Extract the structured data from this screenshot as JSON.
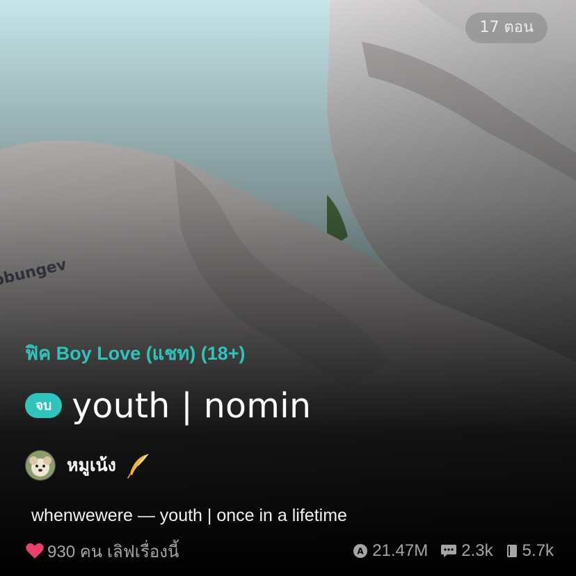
{
  "cover": {
    "episode_count": "17 ตอน",
    "category": "ฟิค Boy Love (แชท) (18+)",
    "status_badge": "จบ",
    "title": "youth | nomin"
  },
  "author": {
    "name": "หมูเน้ง",
    "avatar_icon": "dog-avatar",
    "badge_icon": "feather-icon"
  },
  "description": "whenwewere — youth | once in a lifetime",
  "stats": {
    "love_text": "930 คน เลิฟเรื่องนี้",
    "views": "21.47M",
    "comments": "2.3k",
    "chapters": "5.7k"
  },
  "colors": {
    "accent": "#2ec4bb",
    "heart": "#ec3f6b",
    "muted": "#a5a5a5"
  }
}
